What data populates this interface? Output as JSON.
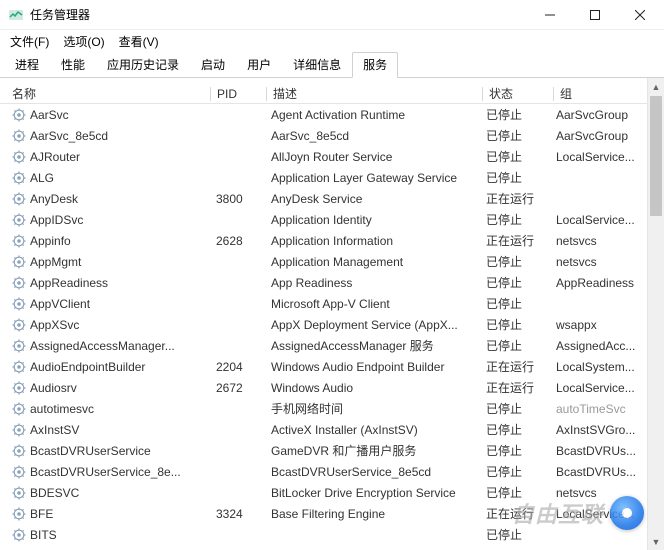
{
  "window": {
    "title": "任务管理器",
    "menus": [
      {
        "label": "文件(F)"
      },
      {
        "label": "选项(O)"
      },
      {
        "label": "查看(V)"
      }
    ],
    "tabs": [
      {
        "label": "进程",
        "active": false
      },
      {
        "label": "性能",
        "active": false
      },
      {
        "label": "应用历史记录",
        "active": false
      },
      {
        "label": "启动",
        "active": false
      },
      {
        "label": "用户",
        "active": false
      },
      {
        "label": "详细信息",
        "active": false
      },
      {
        "label": "服务",
        "active": true
      }
    ]
  },
  "columns": {
    "name": "名称",
    "pid": "PID",
    "desc": "描述",
    "status": "状态",
    "group": "组"
  },
  "status_labels": {
    "stopped": "已停止",
    "running": "正在运行"
  },
  "services": [
    {
      "name": "AarSvc",
      "pid": "",
      "desc": "Agent Activation Runtime",
      "status": "已停止",
      "group": "AarSvcGroup"
    },
    {
      "name": "AarSvc_8e5cd",
      "pid": "",
      "desc": "AarSvc_8e5cd",
      "status": "已停止",
      "group": "AarSvcGroup"
    },
    {
      "name": "AJRouter",
      "pid": "",
      "desc": "AllJoyn Router Service",
      "status": "已停止",
      "group": "LocalService..."
    },
    {
      "name": "ALG",
      "pid": "",
      "desc": "Application Layer Gateway Service",
      "status": "已停止",
      "group": ""
    },
    {
      "name": "AnyDesk",
      "pid": "3800",
      "desc": "AnyDesk Service",
      "status": "正在运行",
      "group": ""
    },
    {
      "name": "AppIDSvc",
      "pid": "",
      "desc": "Application Identity",
      "status": "已停止",
      "group": "LocalService..."
    },
    {
      "name": "Appinfo",
      "pid": "2628",
      "desc": "Application Information",
      "status": "正在运行",
      "group": "netsvcs"
    },
    {
      "name": "AppMgmt",
      "pid": "",
      "desc": "Application Management",
      "status": "已停止",
      "group": "netsvcs"
    },
    {
      "name": "AppReadiness",
      "pid": "",
      "desc": "App Readiness",
      "status": "已停止",
      "group": "AppReadiness"
    },
    {
      "name": "AppVClient",
      "pid": "",
      "desc": "Microsoft App-V Client",
      "status": "已停止",
      "group": ""
    },
    {
      "name": "AppXSvc",
      "pid": "",
      "desc": "AppX Deployment Service (AppX...",
      "status": "已停止",
      "group": "wsappx"
    },
    {
      "name": "AssignedAccessManager...",
      "pid": "",
      "desc": "AssignedAccessManager 服务",
      "status": "已停止",
      "group": "AssignedAcc..."
    },
    {
      "name": "AudioEndpointBuilder",
      "pid": "2204",
      "desc": "Windows Audio Endpoint Builder",
      "status": "正在运行",
      "group": "LocalSystem..."
    },
    {
      "name": "Audiosrv",
      "pid": "2672",
      "desc": "Windows Audio",
      "status": "正在运行",
      "group": "LocalService..."
    },
    {
      "name": "autotimesvc",
      "pid": "",
      "desc": "手机网络时间",
      "status": "已停止",
      "group": "autoTimeSvc",
      "muted": true
    },
    {
      "name": "AxInstSV",
      "pid": "",
      "desc": "ActiveX Installer (AxInstSV)",
      "status": "已停止",
      "group": "AxInstSVGro..."
    },
    {
      "name": "BcastDVRUserService",
      "pid": "",
      "desc": "GameDVR 和广播用户服务",
      "status": "已停止",
      "group": "BcastDVRUs..."
    },
    {
      "name": "BcastDVRUserService_8e...",
      "pid": "",
      "desc": "BcastDVRUserService_8e5cd",
      "status": "已停止",
      "group": "BcastDVRUs..."
    },
    {
      "name": "BDESVC",
      "pid": "",
      "desc": "BitLocker Drive Encryption Service",
      "status": "已停止",
      "group": "netsvcs"
    },
    {
      "name": "BFE",
      "pid": "3324",
      "desc": "Base Filtering Engine",
      "status": "正在运行",
      "group": "LocalService..."
    },
    {
      "name": "BITS",
      "pid": "",
      "desc": "",
      "status": "已停止",
      "group": ""
    }
  ],
  "watermark": {
    "text": "自由互联"
  }
}
